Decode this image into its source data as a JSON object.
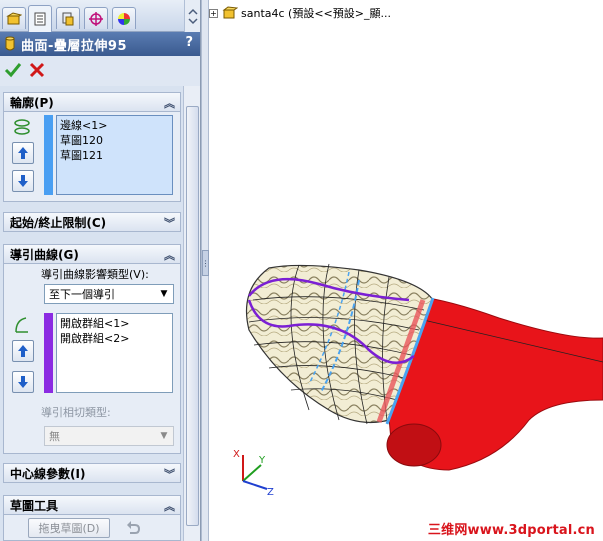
{
  "window": {
    "left_panel_width": "201"
  },
  "tabs": [
    {
      "name": "feature-manager",
      "icon": "feature-tree-icon"
    },
    {
      "name": "property-manager",
      "icon": "property-manager-icon",
      "active": true
    },
    {
      "name": "configuration-manager",
      "icon": "configuration-icon"
    },
    {
      "name": "dimxpert-manager",
      "icon": "crosshair-icon"
    },
    {
      "name": "display-manager",
      "icon": "color-wheel-icon"
    }
  ],
  "property_manager": {
    "title": "曲面-疊層拉伸95",
    "help_label": "?",
    "ok_icon": "checkmark-icon",
    "cancel_icon": "x-icon"
  },
  "groups": {
    "profile": {
      "title": "輪廓(P)",
      "items": [
        "邊線<1>",
        "草圖120",
        "草圖121"
      ]
    },
    "start_end": {
      "title": "起始/終止限制(C)"
    },
    "guides": {
      "title": "導引曲線(G)",
      "influence_label": "導引曲線影響類型(V):",
      "influence_value": "至下一個導引",
      "items": [
        "開啟群組<1>",
        "開啟群組<2>"
      ],
      "tangency_label": "導引相切類型:",
      "tangency_value": "無"
    },
    "centerline": {
      "title": "中心線參數(I)"
    },
    "sketch_tools": {
      "title": "草圖工具",
      "drag_sketch_label": "拖曳草圖(D)"
    }
  },
  "viewport": {
    "tree_text": "santa4c (預設<<預設>_顯..."
  },
  "triad": {
    "x": "X",
    "y": "Y",
    "z": "Z"
  },
  "watermark": "三维网www.3dportal.cn",
  "colors": {
    "profile_bar": "#4a9ff2",
    "guide_bar": "#8b2be2",
    "body_red": "#e8141a",
    "guide_curve": "#7b1fd4",
    "profile_curve": "#4aa3f0"
  }
}
